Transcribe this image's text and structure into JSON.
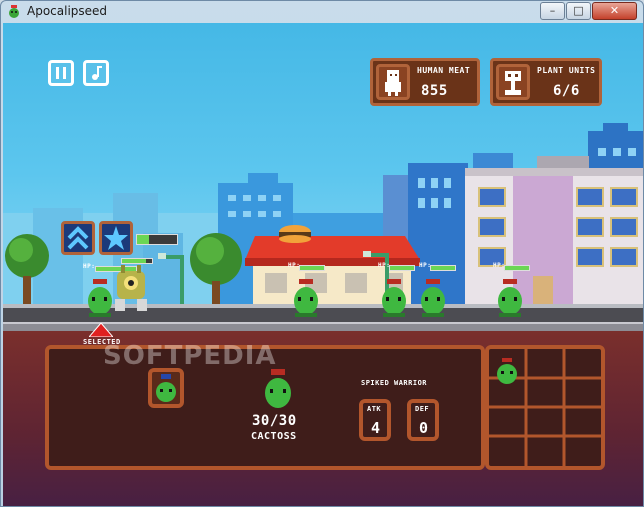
{
  "window": {
    "title": "Apocalipseed",
    "minimize": "–",
    "maximize": "□",
    "close": "✕"
  },
  "hud": {
    "pause_icon": "pause-icon",
    "music_icon": "music-note-icon",
    "human_meat_label": "HUMAN MEAT",
    "human_meat_value": "855",
    "plant_units_label": "PLANT UNITS",
    "plant_units_value": "6/6"
  },
  "field": {
    "hp_label": "HP:",
    "selected_label": "SELECTED"
  },
  "unit_panel": {
    "hp_display": "30/30",
    "unit_name": "CACTOSS",
    "class_name": "SPIKED WARRIOR",
    "atk_label": "ATK",
    "atk_value": "4",
    "def_label": "DEF",
    "def_value": "0"
  },
  "watermark": "SOFTPEDIA",
  "colors": {
    "panel_brown": "#6a3318",
    "panel_border": "#b0633a",
    "sky": "#5cc6ee",
    "hp_green": "#6bd654",
    "selected_red": "#e02020"
  }
}
